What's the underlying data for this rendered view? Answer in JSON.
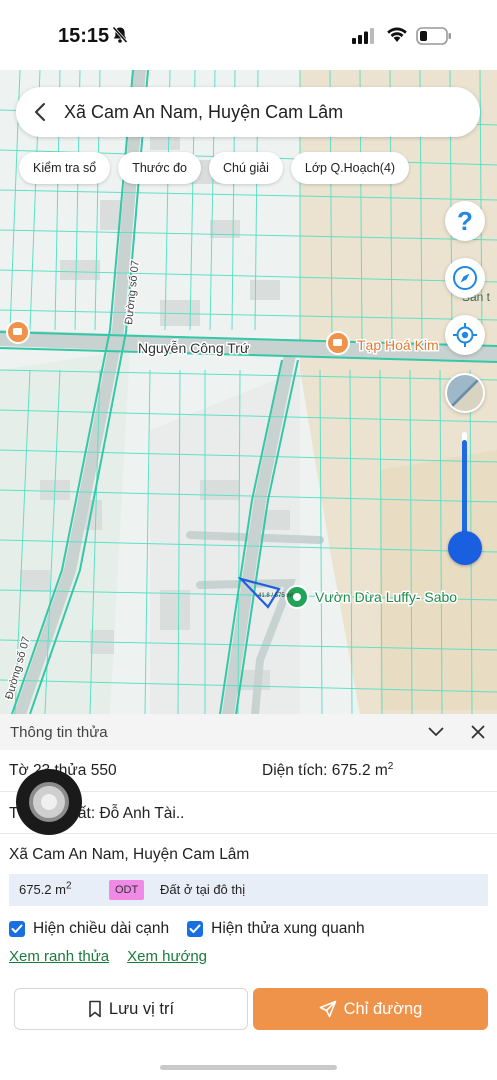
{
  "status_bar": {
    "time": "15:15"
  },
  "search": {
    "title": "Xã Cam An Nam, Huyện Cam Lâm"
  },
  "chips": [
    "Kiểm tra sổ",
    "Thước đo",
    "Chú giải",
    "Lớp Q.Hoạch(4)"
  ],
  "map": {
    "road_labels": [
      "Nguyễn Công Trứ",
      "Đường số 07",
      "Đường số 07"
    ],
    "pois": [
      "Tạp Hoá Kim",
      "Vườn Dừa Luffy- Sabo",
      "Sân t"
    ],
    "parcel_label": "41.8 / 675 m²"
  },
  "panel": {
    "title": "Thông tin thửa",
    "sheet": "Tờ 23 thửa 550",
    "area_label": "Diện tích: 675.2 m",
    "area_unit_sup": "2",
    "owner_label": "Tên chủ đất: Đỗ Anh Tài..",
    "address": "Xã Cam An Nam, Huyện Cam Lâm",
    "landuse": {
      "area": "675.2 m",
      "area_sup": "2",
      "code": "ODT",
      "description": "Đất ở tại đô thị"
    },
    "checkbox_1": "Hiện chiều dài cạnh",
    "checkbox_2": "Hiện thửa xung quanh",
    "link_1": "Xem ranh thửa",
    "link_2": "Xem hướng",
    "save_button": "Lưu vị trí",
    "directions_button": "Chỉ đường"
  },
  "colors": {
    "accent": "#f0934a",
    "blue": "#1a6fe0",
    "link": "#1c7a3c",
    "parcel_line": "#5fe0c6"
  }
}
